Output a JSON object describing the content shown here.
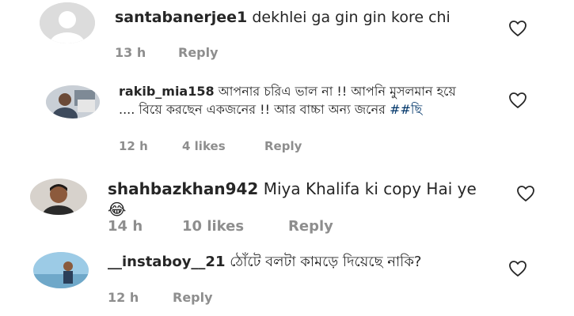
{
  "comments": [
    {
      "username": "santabanerjee1",
      "text": "dekhlei ga gin gin kore chi",
      "hashtag": "",
      "time": "13 h",
      "likes": "",
      "reply": "Reply",
      "avatar_icon": "default-avatar-icon"
    },
    {
      "username": "rakib_mia158",
      "text": "আপনার চরিএ ভাল না !! আপনি মুসলমান হয়ে .... বিয়ে করছেন একজনের !! আর বাচ্চা অন্য জনের",
      "hashtag": "##ছি",
      "time": "12 h",
      "likes": "4 likes",
      "reply": "Reply",
      "avatar_icon": "user-photo-avatar"
    },
    {
      "username": "shahbazkhan942",
      "text": "Miya Khalifa ki copy Hai ye 😂",
      "hashtag": "",
      "time": "14 h",
      "likes": "10 likes",
      "reply": "Reply",
      "avatar_icon": "user-photo-avatar"
    },
    {
      "username": "__instaboy__21",
      "text": "ঠোঁটে বলটা কামড়ে দিয়েছে নাকি?",
      "hashtag": "",
      "time": "12 h",
      "likes": "",
      "reply": "Reply",
      "avatar_icon": "user-photo-avatar"
    }
  ],
  "icons": {
    "like": "heart-outline-icon"
  },
  "colors": {
    "text": "#262626",
    "meta": "#8e8e8e",
    "hashtag": "#003569",
    "avatar_placeholder": "#dbdbdb"
  }
}
